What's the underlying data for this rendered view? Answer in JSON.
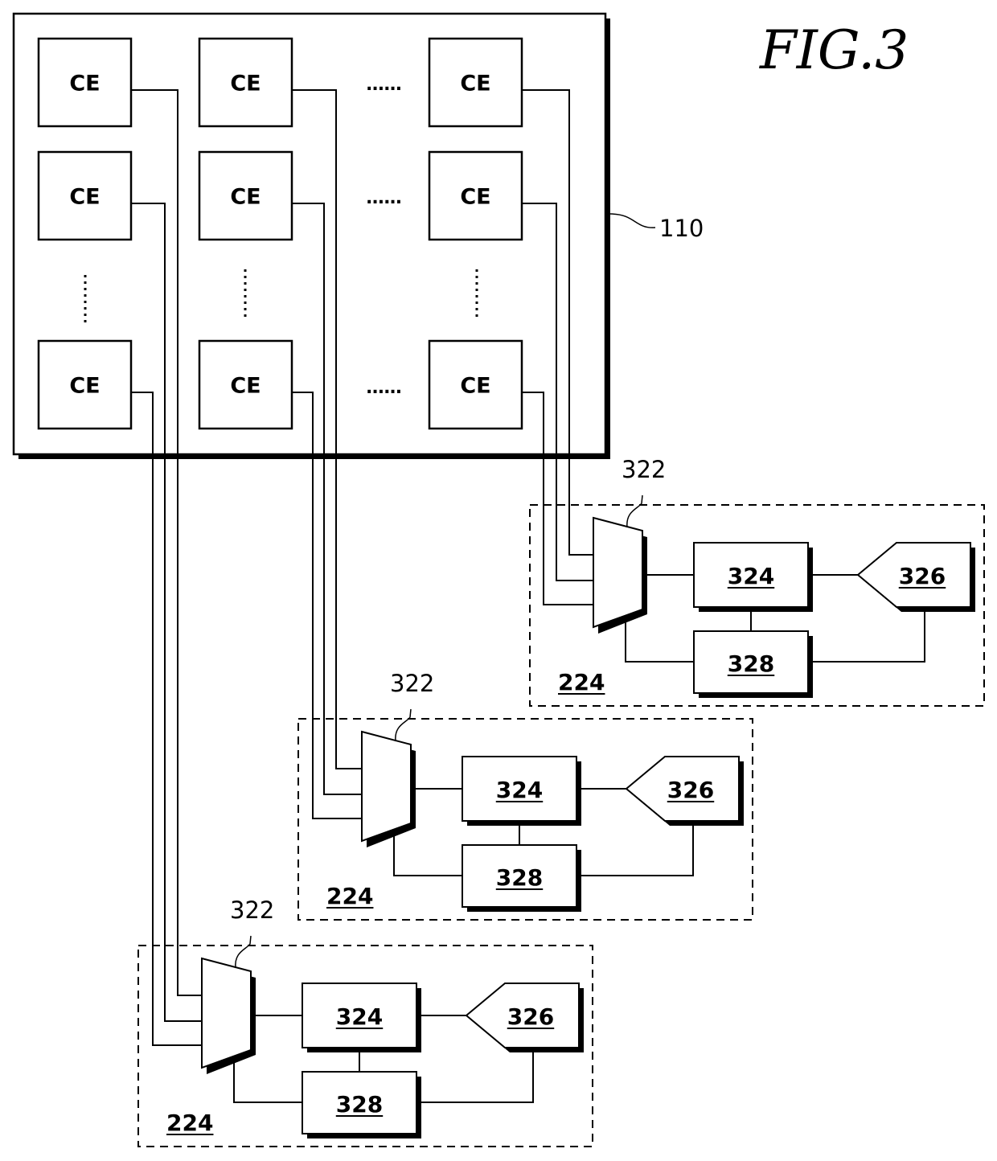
{
  "figure": {
    "title": "FIG.3"
  },
  "array": {
    "ref": "110",
    "element_label": "CE",
    "h_ellipsis": "......",
    "rows": [
      {
        "cells": [
          "CE",
          "CE",
          "CE"
        ]
      },
      {
        "cells": [
          "CE",
          "CE",
          "CE"
        ]
      },
      {
        "cells": [
          "CE",
          "CE",
          "CE"
        ]
      }
    ]
  },
  "modules": [
    {
      "ref": "224",
      "mux_ref": "322",
      "block_a": "324",
      "block_b": "326",
      "block_c": "328"
    },
    {
      "ref": "224",
      "mux_ref": "322",
      "block_a": "324",
      "block_b": "326",
      "block_c": "328"
    },
    {
      "ref": "224",
      "mux_ref": "322",
      "block_a": "324",
      "block_b": "326",
      "block_c": "328"
    }
  ]
}
